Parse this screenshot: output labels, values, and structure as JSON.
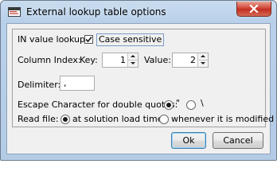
{
  "window": {
    "title": "External lookup table options",
    "icon": "app-window-icon",
    "close_icon": "close-icon"
  },
  "options": {
    "in_value_lookup_label": "IN value lookup:",
    "case_sensitive_label": "Case sensitive",
    "case_sensitive_checked": true,
    "column_index_label": "Column Index:",
    "key_label": "Key:",
    "key_value": "1",
    "value_label": "Value:",
    "value_value": "2",
    "delimiter_label": "Delimiter:",
    "delimiter_value": ",",
    "escape_label": "Escape Character for double quotes:",
    "escape_options": [
      {
        "label": "\"",
        "selected": true
      },
      {
        "label": "\\",
        "selected": false
      }
    ],
    "read_file_label": "Read file:",
    "read_file_options": [
      {
        "label": "at solution load time",
        "selected": true
      },
      {
        "label": "whenever it is modified",
        "selected": false
      }
    ]
  },
  "buttons": {
    "ok": "Ok",
    "cancel": "Cancel"
  },
  "colors": {
    "titlebar": "#b9d0ea",
    "client": "#f0f0f0",
    "close_button": "#c9412f"
  }
}
